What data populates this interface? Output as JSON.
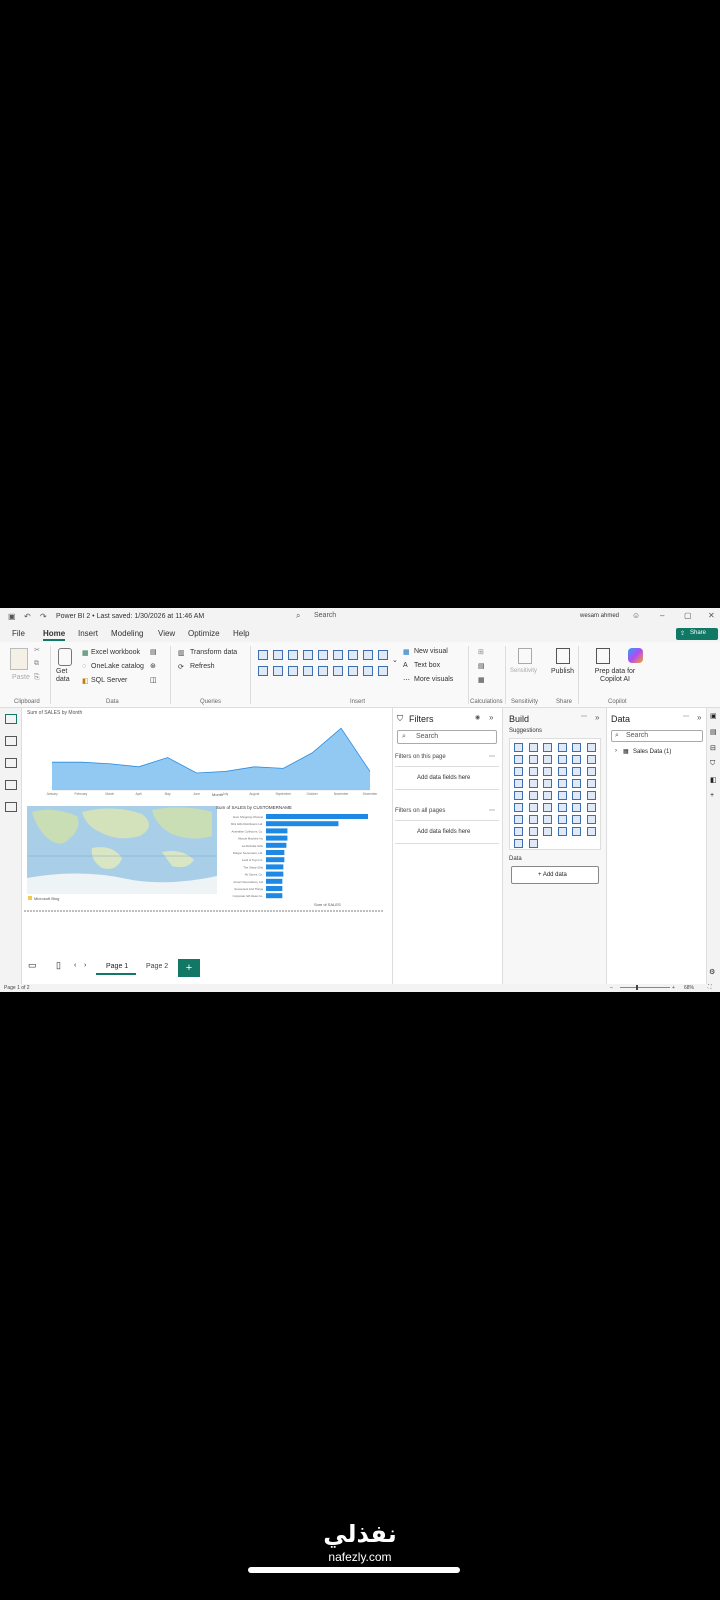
{
  "titlebar": {
    "title": "Power BI 2 • Last saved: 1/30/2026 at 11:46 AM",
    "search": "Search",
    "user": "wesam ahmed",
    "share": "Share"
  },
  "menu": [
    "File",
    "Home",
    "Insert",
    "Modeling",
    "View",
    "Optimize",
    "Help"
  ],
  "ribbon": {
    "paste": "Paste",
    "get_data": "Get data",
    "excel": "Excel workbook",
    "onelake": "OneLake catalog",
    "sql": "SQL Server",
    "transform": "Transform data",
    "refresh": "Refresh",
    "new_visual": "New visual",
    "text_box": "Text box",
    "more_visuals": "More visuals",
    "sensitivity": "Sensitivity",
    "publish": "Publish",
    "prep": "Prep data for Copilot AI",
    "groups": [
      "Clipboard",
      "Data",
      "Queries",
      "Insert",
      "Calculations",
      "Sensitivity",
      "Share",
      "Copilot"
    ]
  },
  "filters": {
    "title": "Filters",
    "search": "Search",
    "on_page": "Filters on this page",
    "add1": "Add data fields here",
    "on_all": "Filters on all pages",
    "add2": "Add data fields here"
  },
  "build": {
    "title": "Build",
    "suggestions": "Suggestions",
    "data_label": "Data",
    "add_data": "+ Add data"
  },
  "data_pane": {
    "title": "Data",
    "search": "Search",
    "table": "Sales Data (1)"
  },
  "pages": [
    "Page 1",
    "Page 2"
  ],
  "status": {
    "page": "Page 1 of 2",
    "zoom": "68%"
  },
  "charts": {
    "area_title": "Sum of SALES by Month",
    "area_xlabel": "Month",
    "bar_title": "Sum of SALES by CUSTOMERNAME",
    "bar_xlabel": "Sum of SALES",
    "map_credit": "Microsoft Bing"
  },
  "chart_data": [
    {
      "type": "area",
      "title": "Sum of SALES by Month",
      "xlabel": "Month",
      "categories": [
        "January",
        "February",
        "March",
        "April",
        "May",
        "June",
        "July",
        "August",
        "September",
        "October",
        "November",
        "December"
      ],
      "values": [
        0.9,
        0.9,
        0.85,
        0.75,
        1.05,
        0.55,
        0.6,
        0.75,
        0.7,
        1.2,
        2.0,
        0.6
      ]
    },
    {
      "type": "bar",
      "title": "Sum of SALES by CUSTOMERNAME",
      "xlabel": "Sum of SALES",
      "categories": [
        "Euro Shopping Channel",
        "Mini Gifts Distributors Ltd.",
        "Australian Collectors, Co.",
        "Muscle Machine Inc",
        "La Rochelle Gifts",
        "Dragon Souveniers, Ltd.",
        "Land of Toys Inc.",
        "The Sharp Gifts",
        "AV Stores, Co.",
        "Anna's Decorations, Ltd",
        "Souveniers And Things",
        "Corporate Gift Ideas Co."
      ],
      "values": [
        100,
        71,
        21,
        21,
        20,
        18,
        18,
        17,
        17,
        16,
        16,
        16
      ]
    }
  ],
  "watermark": {
    "arabic": "نفذلي",
    "site": "nafezly.com"
  }
}
